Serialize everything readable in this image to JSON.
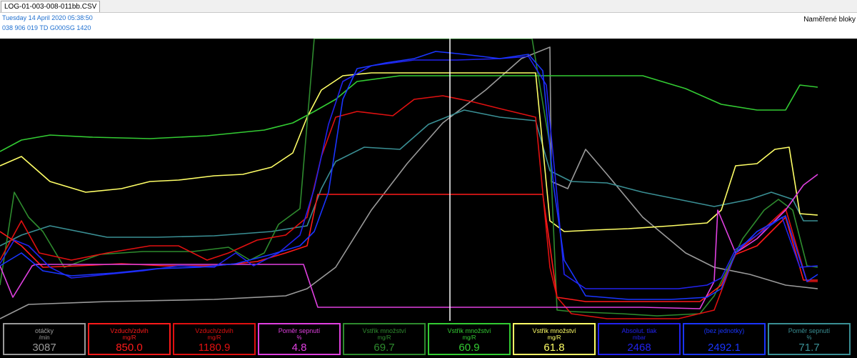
{
  "tab": {
    "label": "LOG-01-003-008-011bb.CSV"
  },
  "info": {
    "line1": "Tuesday 14 April 2020 05:38:50",
    "line2": "038 906 019 TD  G000SG  1420",
    "blocks_label": "Naměřené bloky"
  },
  "colors": {
    "gray": "#9a9a9a",
    "red": "#ff1a1a",
    "red2": "#e01010",
    "magenta": "#e040e0",
    "darkgreen": "#2e8b2e",
    "green": "#33cc33",
    "yellow": "#ffff66",
    "blue": "#2222ee",
    "blue2": "#1a35ff",
    "teal": "#3a8f94"
  },
  "cursor": {
    "position": 0.525
  },
  "panels": [
    {
      "name": "otáčky",
      "unit": "/min",
      "value": "3087",
      "color": "gray"
    },
    {
      "name": "Vzduch/zdvih",
      "unit": "mg/R",
      "value": "850.0",
      "color": "red"
    },
    {
      "name": "Vzduch/zdvih",
      "unit": "mg/R",
      "value": "1180.9",
      "color": "red2"
    },
    {
      "name": "Poměr sepnutí",
      "unit": "%",
      "value": "4.8",
      "color": "magenta"
    },
    {
      "name": "Vstřik množství",
      "unit": "mg/R",
      "value": "69.7",
      "color": "darkgreen"
    },
    {
      "name": "Vstřik množství",
      "unit": "mg/R",
      "value": "60.9",
      "color": "green"
    },
    {
      "name": "Vstřik množství",
      "unit": "mg/R",
      "value": "61.8",
      "color": "yellow"
    },
    {
      "name": "Absolut. tlak",
      "unit": "mbar",
      "value": "2468",
      "color": "blue"
    },
    {
      "name": "(bez jednotky)",
      "unit": "",
      "value": "2492.1",
      "color": "blue2"
    },
    {
      "name": "Poměr sepnutí",
      "unit": "%",
      "value": "71.7",
      "color": "teal"
    }
  ]
}
